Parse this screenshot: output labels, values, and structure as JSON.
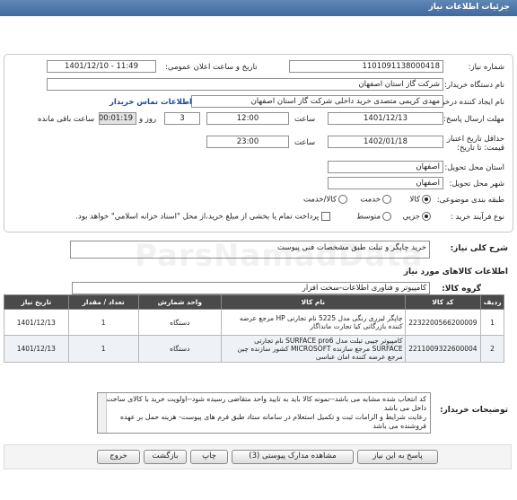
{
  "header": {
    "title": "جزئیات اطلاعات نیاز"
  },
  "form": {
    "need_number_label": "شماره نیاز:",
    "need_number": "1101091138000418",
    "announce_label": "تاریخ و ساعت اعلان عمومی:",
    "announce_value": "1401/12/10 - 11:49",
    "buyer_org_label": "نام دستگاه خریدار:",
    "buyer_org": "شرکت گاز استان اصفهان",
    "creator_label": "نام ایجاد کننده درخواست:",
    "creator": "مهدی کریمی متصدی خرید داخلی شرکت گاز استان اصفهان",
    "contact_link": "اطلاعات تماس خریدار",
    "deadline_label": "مهلت ارسال پاسخ: تا تاریخ:",
    "deadline_date": "1401/12/13",
    "time_label": "ساعت",
    "deadline_time": "12:00",
    "days": "3",
    "day_label": "روز و",
    "remaining": "00:01:19",
    "remaining_label": "ساعت باقی مانده",
    "validity_label": "حداقل تاریخ اعتبار قیمت: تا تاریخ:",
    "validity_date": "1402/01/18",
    "validity_time_label": "ساعت",
    "validity_time": "23:00",
    "province_label": "استان محل تحویل:",
    "province": "اصفهان",
    "city_label": "شهر محل تحویل:",
    "city": "اصفهان",
    "category_label": "طبقه بندی موضوعی:",
    "category_opts": [
      "کالا",
      "خدمت",
      "کالا/خدمت"
    ],
    "process_label": "نوع فرآیند خرید :",
    "process_opts": [
      "جزیی",
      "متوسط"
    ],
    "payment_note": "پرداخت تمام یا بخشی از مبلغ خرید،از محل \"اسناد خزانه اسلامی\" خواهد بود."
  },
  "summary": {
    "label": "شرح کلی نیاز:",
    "value": "خرید چاپگر و تبلت طبق مشخصات فنی پیوست"
  },
  "goods": {
    "section_title": "اطلاعات کالاهای مورد نیاز",
    "group_label": "گروه کالا:",
    "group_value": "کامپیوتر و فناوری اطلاعات-سخت افزار"
  },
  "table": {
    "headers": [
      "ردیف",
      "کد کالا",
      "نام کالا",
      "واحد شمارش",
      "تعداد / مقدار",
      "تاریخ نیاز"
    ],
    "rows": [
      {
        "idx": "1",
        "code": "2232200566200009",
        "name": "چاپگر لیزری رنگی مدل 5225 نام تجارتی HP مرجع عرضه کننده بازرگانی کیا تجارت مانداگار",
        "unit": "دستگاه",
        "qty": "1",
        "date": "1401/12/13"
      },
      {
        "idx": "2",
        "code": "2211009322600004",
        "name": "کامپیوتر جیبی تبلت مدل SURFACE pro6 نام تجارتی SURFACE مرجع سازنده MICROSOFT کشور سازنده چین مرجع عرضه کننده امان عباسی",
        "unit": "دستگاه",
        "qty": "1",
        "date": "1401/12/13"
      }
    ]
  },
  "notes": {
    "label": "توضیحات خریدار:",
    "text": "کد انتخاب شده مشابه می باشد--نمونه کالا باید به تایید واحد متقاضی رسیده شود--اولویت خرید با کالای ساخت داخل می باشد\nرعایت شرایط و الزامات ثبت و تکمیل استعلام در سامانه ستاد  طبق فرم های پیوست- هزینه حمل بر عهده فروشنده می باشد"
  },
  "buttons": {
    "reply": "پاسخ به این نیاز",
    "attachments": "مشاهده مدارک پیوستی (3)",
    "print": "چاپ",
    "back": "بازگشت",
    "exit": "خروج"
  },
  "watermark": "ParsNamadData"
}
